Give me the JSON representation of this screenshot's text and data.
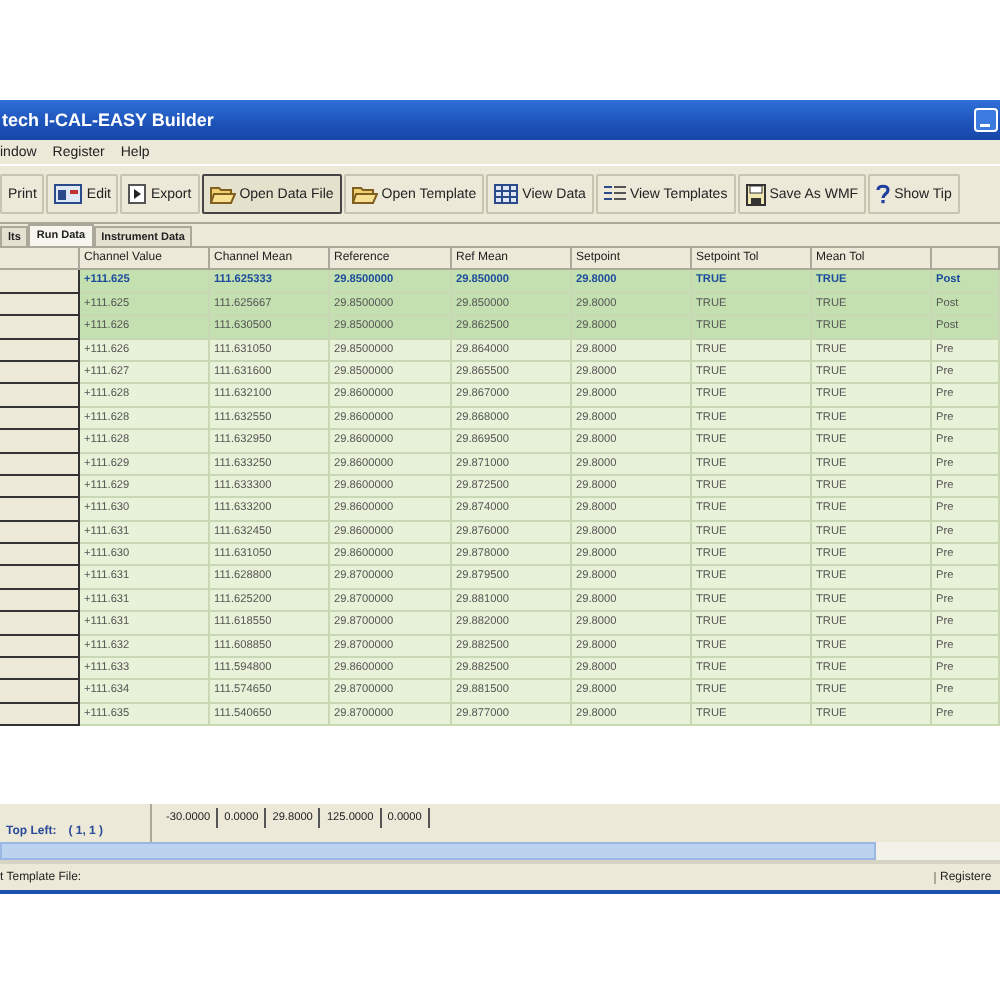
{
  "window": {
    "title": "tech I-CAL-EASY Builder"
  },
  "menu": [
    "indow",
    "Register",
    "Help"
  ],
  "toolbar": [
    {
      "label": "Print",
      "pressed": false
    },
    {
      "label": "Edit",
      "pressed": false
    },
    {
      "label": "Export",
      "pressed": false
    },
    {
      "label": "Open Data File",
      "pressed": true
    },
    {
      "label": "Open Template",
      "pressed": false
    },
    {
      "label": "View Data",
      "pressed": false
    },
    {
      "label": "View Templates",
      "pressed": false
    },
    {
      "label": "Save As WMF",
      "pressed": false
    },
    {
      "label": "Show Tip",
      "pressed": false
    }
  ],
  "tabs": [
    {
      "label": "lts",
      "selected": false
    },
    {
      "label": "Run Data",
      "selected": true
    },
    {
      "label": "Instrument Data",
      "selected": false
    }
  ],
  "table": {
    "columns": [
      "Channel Value",
      "Channel Mean",
      "Reference",
      "Ref Mean",
      "Setpoint",
      "Setpoint Tol",
      "Mean Tol"
    ],
    "rows": [
      {
        "selected": true,
        "cells": [
          "+111.625",
          "111.625333",
          "29.8500000",
          "29.850000",
          "29.8000",
          "TRUE",
          "TRUE",
          "Post"
        ]
      },
      {
        "selected": false,
        "cells": [
          "+111.625",
          "111.625667",
          "29.8500000",
          "29.850000",
          "29.8000",
          "TRUE",
          "TRUE",
          "Post"
        ]
      },
      {
        "selected": false,
        "cells": [
          "+111.626",
          "111.630500",
          "29.8500000",
          "29.862500",
          "29.8000",
          "TRUE",
          "TRUE",
          "Post"
        ]
      },
      {
        "selected": false,
        "cells": [
          "+111.626",
          "111.631050",
          "29.8500000",
          "29.864000",
          "29.8000",
          "TRUE",
          "TRUE",
          "Pre"
        ]
      },
      {
        "selected": false,
        "cells": [
          "+111.627",
          "111.631600",
          "29.8500000",
          "29.865500",
          "29.8000",
          "TRUE",
          "TRUE",
          "Pre"
        ]
      },
      {
        "selected": false,
        "cells": [
          "+111.628",
          "111.632100",
          "29.8600000",
          "29.867000",
          "29.8000",
          "TRUE",
          "TRUE",
          "Pre"
        ]
      },
      {
        "selected": false,
        "cells": [
          "+111.628",
          "111.632550",
          "29.8600000",
          "29.868000",
          "29.8000",
          "TRUE",
          "TRUE",
          "Pre"
        ]
      },
      {
        "selected": false,
        "cells": [
          "+111.628",
          "111.632950",
          "29.8600000",
          "29.869500",
          "29.8000",
          "TRUE",
          "TRUE",
          "Pre"
        ]
      },
      {
        "selected": false,
        "cells": [
          "+111.629",
          "111.633250",
          "29.8600000",
          "29.871000",
          "29.8000",
          "TRUE",
          "TRUE",
          "Pre"
        ]
      },
      {
        "selected": false,
        "cells": [
          "+111.629",
          "111.633300",
          "29.8600000",
          "29.872500",
          "29.8000",
          "TRUE",
          "TRUE",
          "Pre"
        ]
      },
      {
        "selected": false,
        "cells": [
          "+111.630",
          "111.633200",
          "29.8600000",
          "29.874000",
          "29.8000",
          "TRUE",
          "TRUE",
          "Pre"
        ]
      },
      {
        "selected": false,
        "cells": [
          "+111.631",
          "111.632450",
          "29.8600000",
          "29.876000",
          "29.8000",
          "TRUE",
          "TRUE",
          "Pre"
        ]
      },
      {
        "selected": false,
        "cells": [
          "+111.630",
          "111.631050",
          "29.8600000",
          "29.878000",
          "29.8000",
          "TRUE",
          "TRUE",
          "Pre"
        ]
      },
      {
        "selected": false,
        "cells": [
          "+111.631",
          "111.628800",
          "29.8700000",
          "29.879500",
          "29.8000",
          "TRUE",
          "TRUE",
          "Pre"
        ]
      },
      {
        "selected": false,
        "cells": [
          "+111.631",
          "111.625200",
          "29.8700000",
          "29.881000",
          "29.8000",
          "TRUE",
          "TRUE",
          "Pre"
        ]
      },
      {
        "selected": false,
        "cells": [
          "+111.631",
          "111.618550",
          "29.8700000",
          "29.882000",
          "29.8000",
          "TRUE",
          "TRUE",
          "Pre"
        ]
      },
      {
        "selected": false,
        "cells": [
          "+111.632",
          "111.608850",
          "29.8700000",
          "29.882500",
          "29.8000",
          "TRUE",
          "TRUE",
          "Pre"
        ]
      },
      {
        "selected": false,
        "cells": [
          "+111.633",
          "111.594800",
          "29.8600000",
          "29.882500",
          "29.8000",
          "TRUE",
          "TRUE",
          "Pre"
        ]
      },
      {
        "selected": false,
        "cells": [
          "+111.634",
          "111.574650",
          "29.8700000",
          "29.881500",
          "29.8000",
          "TRUE",
          "TRUE",
          "Pre"
        ]
      },
      {
        "selected": false,
        "cells": [
          "+111.635",
          "111.540650",
          "29.8700000",
          "29.877000",
          "29.8000",
          "TRUE",
          "TRUE",
          "Pre"
        ]
      }
    ]
  },
  "position": {
    "label": "Top Left:",
    "value": "( 1, 1 )"
  },
  "readouts": [
    "-30.0000",
    "0.0000",
    "29.8000",
    "125.0000",
    "0.0000"
  ],
  "status_bar": [
    "t Template File:",
    "Registere"
  ]
}
